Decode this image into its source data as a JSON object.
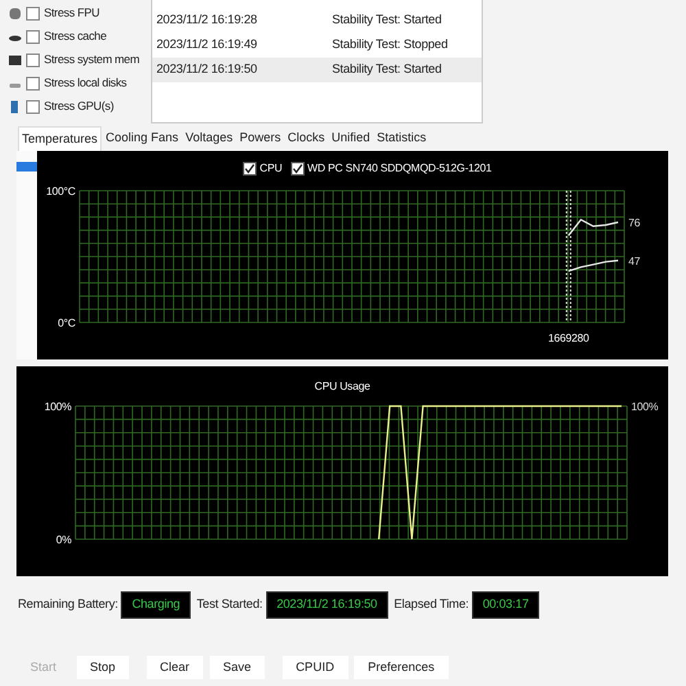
{
  "stress_options": [
    {
      "label": "Stress FPU",
      "checked": false,
      "kind": "fpu"
    },
    {
      "label": "Stress cache",
      "checked": false,
      "kind": "cache"
    },
    {
      "label": "Stress system mem",
      "checked": false,
      "kind": "memory"
    },
    {
      "label": "Stress local disks",
      "checked": false,
      "kind": "disk"
    },
    {
      "label": "Stress GPU(s)",
      "checked": false,
      "kind": "gpu"
    }
  ],
  "log": [
    {
      "time": "2023/11/2 16:19:28",
      "status": "Stability Test: Started",
      "selected": false
    },
    {
      "time": "2023/11/2 16:19:49",
      "status": "Stability Test: Stopped",
      "selected": false
    },
    {
      "time": "2023/11/2 16:19:50",
      "status": "Stability Test: Started",
      "selected": true
    }
  ],
  "tabs": [
    {
      "label": "Temperatures",
      "selected": true
    },
    {
      "label": "Cooling Fans",
      "selected": false
    },
    {
      "label": "Voltages",
      "selected": false
    },
    {
      "label": "Powers",
      "selected": false
    },
    {
      "label": "Clocks",
      "selected": false
    },
    {
      "label": "Unified",
      "selected": false
    },
    {
      "label": "Statistics",
      "selected": false
    }
  ],
  "temperature_chart": {
    "legend": [
      {
        "checked": true
      },
      {
        "checked": true
      }
    ],
    "chart_data": {
      "type": "line",
      "categories": [
        null,
        null,
        null,
        null,
        null,
        null,
        null,
        null,
        null,
        null,
        null,
        null,
        null,
        null,
        null,
        null,
        null,
        null,
        null,
        null,
        null,
        null,
        null,
        null,
        null,
        null,
        null,
        null,
        null,
        null,
        null,
        null,
        null,
        null,
        null,
        null,
        null,
        null,
        null,
        null,
        null,
        null,
        null,
        null
      ],
      "ylim": [
        0,
        100
      ],
      "yticks": [
        {
          "value": 0,
          "label": "0°C"
        },
        {
          "value": 100,
          "label": "100°C"
        }
      ],
      "series": [
        {
          "name": "CPU",
          "color": "#e6e6e6",
          "values": [
            null,
            null,
            null,
            null,
            null,
            null,
            null,
            null,
            null,
            null,
            null,
            null,
            null,
            null,
            null,
            null,
            null,
            null,
            null,
            null,
            null,
            null,
            null,
            null,
            null,
            null,
            null,
            null,
            null,
            null,
            null,
            null,
            null,
            null,
            null,
            null,
            null,
            null,
            null,
            66,
            78,
            73,
            74,
            76
          ]
        },
        {
          "name": "WD PC SN740 SDDQMQD-512G-1201",
          "color": "#e6e6e6",
          "values": [
            null,
            null,
            null,
            null,
            null,
            null,
            null,
            null,
            null,
            null,
            null,
            null,
            null,
            null,
            null,
            null,
            null,
            null,
            null,
            null,
            null,
            null,
            null,
            null,
            null,
            null,
            null,
            null,
            null,
            null,
            null,
            null,
            null,
            null,
            null,
            null,
            null,
            null,
            null,
            39,
            42,
            44,
            46,
            47
          ]
        }
      ],
      "value_labels": [
        "76",
        "47"
      ],
      "annotations": [
        "1669280"
      ],
      "grid": true
    }
  },
  "usage_chart": {
    "chart_data": {
      "type": "line",
      "categories": [
        null,
        null,
        null,
        null,
        null,
        null,
        null,
        null,
        null,
        null,
        null,
        null,
        null,
        null,
        null,
        null,
        null,
        null,
        null,
        null,
        null,
        null,
        null,
        null,
        null,
        null,
        null,
        null,
        null,
        null,
        null,
        null,
        null,
        null,
        null,
        null,
        null,
        null,
        null,
        null,
        null,
        null,
        null,
        null,
        null,
        null,
        null,
        null,
        null,
        null
      ],
      "ylim": [
        0,
        100
      ],
      "yticks": [
        {
          "value": 0,
          "label": "0%"
        },
        {
          "value": 100,
          "label": "100%"
        }
      ],
      "series": [
        {
          "name": "CPU Usage",
          "color": "#e8f08c",
          "values": [
            null,
            null,
            null,
            null,
            null,
            null,
            null,
            null,
            null,
            null,
            null,
            null,
            null,
            null,
            null,
            null,
            null,
            null,
            null,
            null,
            null,
            null,
            null,
            null,
            null,
            null,
            null,
            0,
            100,
            100,
            0,
            100,
            100,
            100,
            100,
            100,
            100,
            100,
            100,
            100,
            100,
            100,
            100,
            100,
            100,
            100,
            100,
            100,
            100,
            100
          ]
        }
      ],
      "value_labels": [
        "100%"
      ],
      "grid": true
    }
  },
  "status": [
    {
      "label": "Remaining Battery:",
      "value": "Charging"
    },
    {
      "label": "Test Started:",
      "value": "2023/11/2 16:19:50"
    },
    {
      "label": "Elapsed Time:",
      "value": "00:03:17"
    }
  ],
  "buttons": [
    {
      "label": "Start",
      "disabled": true
    },
    {
      "label": "Stop",
      "disabled": false
    },
    {
      "label": "Clear",
      "disabled": false
    },
    {
      "label": "Save",
      "disabled": false
    },
    {
      "label": "CPUID",
      "disabled": false
    },
    {
      "label": "Preferences",
      "disabled": false
    }
  ]
}
